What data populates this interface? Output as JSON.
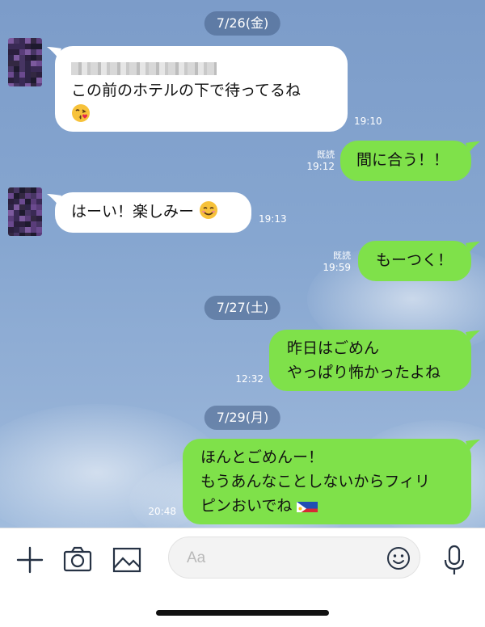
{
  "dates": [
    "7/26(金)",
    "7/27(土)",
    "7/29(月)"
  ],
  "messages": [
    {
      "dir": "in",
      "lines": [
        "この前のホテルの下で待ってるね"
      ],
      "emoji": "kissing-heart",
      "time": "19:10"
    },
    {
      "dir": "out",
      "lines": [
        "間に合う！！"
      ],
      "read": "既読",
      "time": "19:12"
    },
    {
      "dir": "in",
      "lines": [
        "はーい！楽しみー"
      ],
      "emoji": "smiling",
      "time": "19:13"
    },
    {
      "dir": "out",
      "lines": [
        "もーつく！"
      ],
      "read": "既読",
      "time": "19:59"
    },
    {
      "dir": "out",
      "lines": [
        "昨日はごめん",
        "やっぱり怖かったよね"
      ],
      "time": "12:32"
    },
    {
      "dir": "out",
      "lines": [
        "ほんとごめんー！",
        "もうあんなことしないからフィリ",
        "ピンおいでね"
      ],
      "emoji": "philippines-flag",
      "time": "20:48"
    }
  ],
  "composer": {
    "placeholder": "Aa"
  },
  "icons": [
    "plus-icon",
    "camera-icon",
    "image-icon",
    "emoji-icon",
    "microphone-icon"
  ],
  "colors": {
    "outgoing": "#7fe14a",
    "incoming": "#ffffff",
    "background": "#86a6d0"
  }
}
